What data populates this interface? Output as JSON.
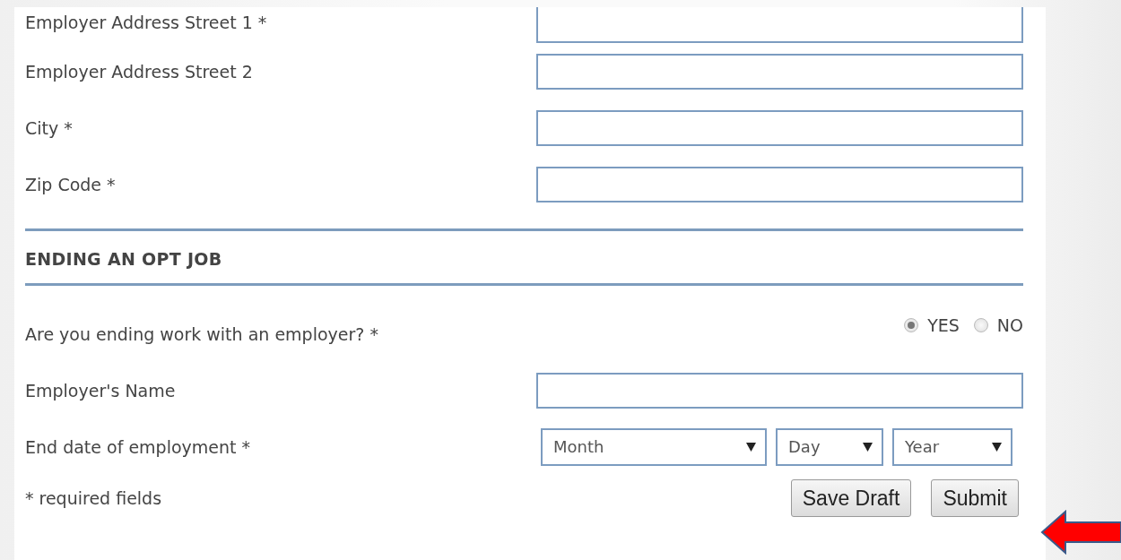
{
  "address_fields": [
    {
      "label": "Employer Address Street 1 *",
      "kind": "text"
    },
    {
      "label": "Employer Address Street 2",
      "kind": "text"
    },
    {
      "label": "City *",
      "kind": "text"
    },
    {
      "label": "Zip Code *",
      "kind": "text"
    }
  ],
  "section": {
    "heading": "ENDING AN OPT JOB",
    "fields": [
      {
        "label": "Are you ending work with an employer? *",
        "kind": "radio",
        "options": [
          {
            "label": "YES",
            "selected": true
          },
          {
            "label": "NO",
            "selected": false
          }
        ]
      },
      {
        "label": "Employer's Name",
        "kind": "text"
      },
      {
        "label": "End date of employment *",
        "kind": "date",
        "selects": [
          "Month",
          "Day",
          "Year"
        ]
      }
    ]
  },
  "footer": {
    "note": "* required fields",
    "buttons": [
      "Save Draft",
      "Submit"
    ]
  }
}
